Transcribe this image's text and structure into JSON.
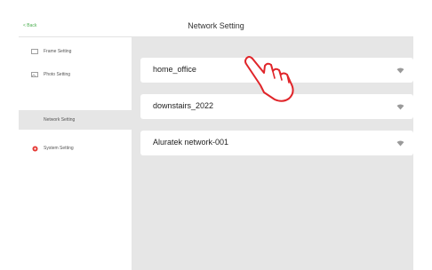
{
  "header": {
    "back_label": "< Back",
    "title": "Network Setting"
  },
  "sidebar": {
    "items": [
      {
        "label": "Frame Setting",
        "icon": "frame-icon",
        "active": false
      },
      {
        "label": "Photo Setting",
        "icon": "photo-icon",
        "active": false
      },
      {
        "label": "Network Setting",
        "icon": "network-icon",
        "active": true
      },
      {
        "label": "System Setting",
        "icon": "system-gear-icon",
        "active": false
      }
    ]
  },
  "networks": [
    {
      "ssid": "home_office",
      "icon": "wifi-icon"
    },
    {
      "ssid": "downstairs_2022",
      "icon": "wifi-icon"
    },
    {
      "ssid": "Aluratek network-001",
      "icon": "wifi-icon"
    }
  ],
  "colors": {
    "accent_green": "#4caf50",
    "system_icon_red": "#e53935",
    "pointer_red": "#e0252a",
    "panel_gray": "#e6e6e6"
  }
}
